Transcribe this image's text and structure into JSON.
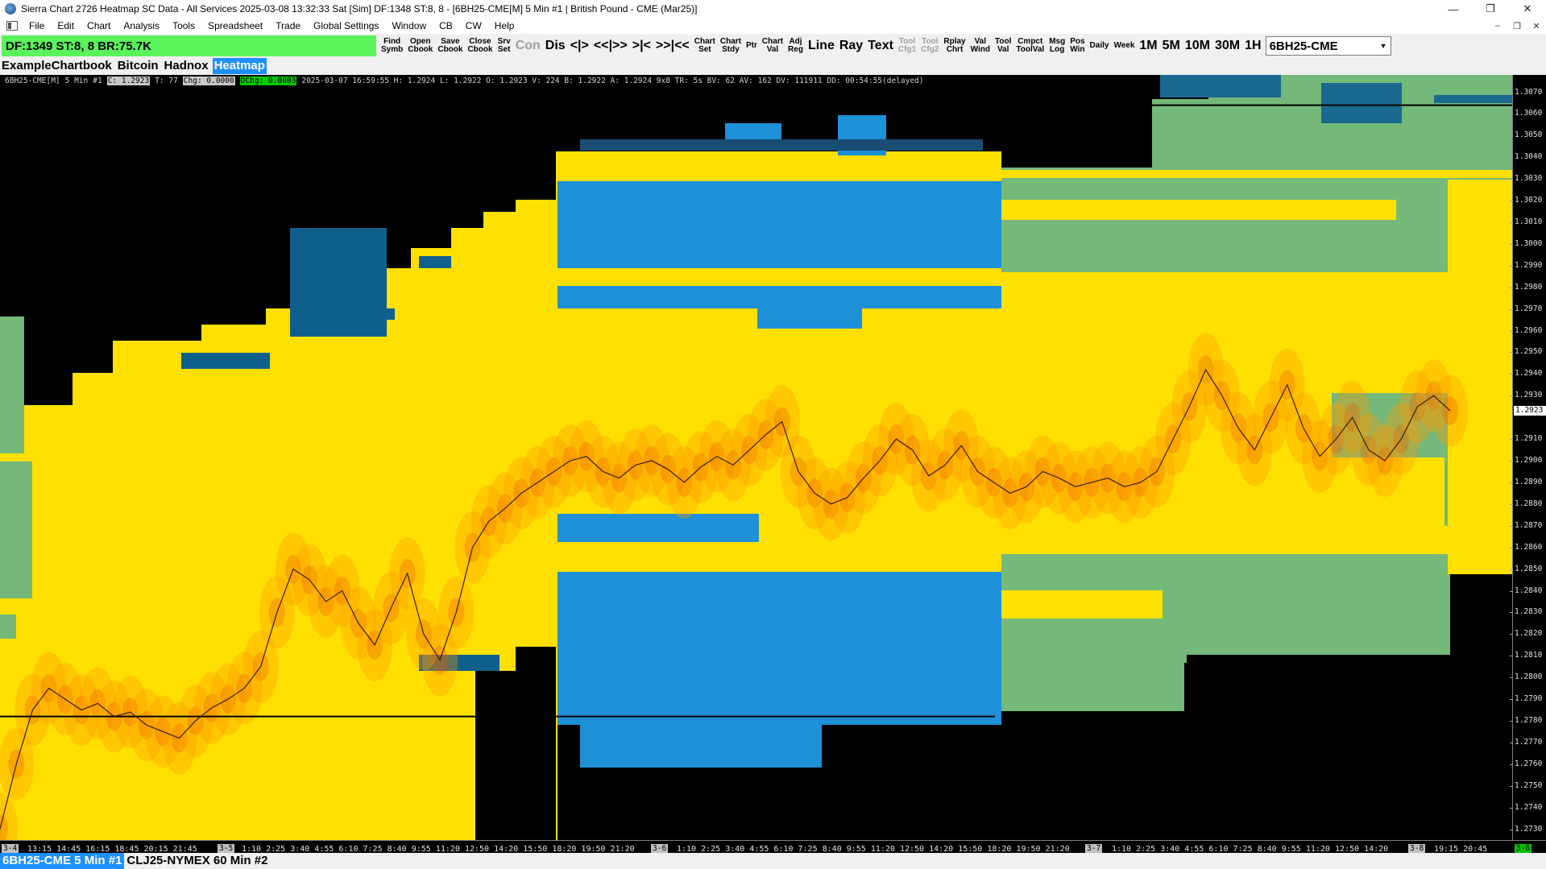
{
  "window": {
    "title": "Sierra Chart 2726 Heatmap SC Data - All Services 2025-03-08  13:32:33 Sat [Sim] DF:1348  ST:8, 8 - [6BH25-CME[M]  5 Min  #1 | British Pound - CME (Mar25)]",
    "minimize": "—",
    "maximize": "❐",
    "close": "✕"
  },
  "menu": {
    "items": [
      "File",
      "Edit",
      "Chart",
      "Analysis",
      "Tools",
      "Spreadsheet",
      "Trade",
      "Global Settings",
      "Window",
      "CB",
      "CW",
      "Help"
    ],
    "mdi": [
      "–",
      "❐",
      "✕"
    ]
  },
  "toolbar": {
    "status": "DF:1349  ST:8, 8  BR:75.7K",
    "buttons": [
      {
        "l1": "Find",
        "l2": "Symb",
        "disabled": false
      },
      {
        "l1": "Open",
        "l2": "Cbook",
        "disabled": false
      },
      {
        "l1": "Save",
        "l2": "Cbook",
        "disabled": false
      },
      {
        "l1": "Close",
        "l2": "Cbook",
        "disabled": false
      },
      {
        "l1": "Srv",
        "l2": "Set",
        "disabled": false
      }
    ],
    "big_buttons_1": [
      {
        "label": "Con",
        "disabled": true
      },
      {
        "label": "Dis",
        "disabled": false
      },
      {
        "label": "<|>",
        "disabled": false
      },
      {
        "label": "<<|>>",
        "disabled": false
      },
      {
        "label": ">|<",
        "disabled": false
      },
      {
        "label": ">>|<<",
        "disabled": false
      }
    ],
    "buttons_2": [
      {
        "l1": "Chart",
        "l2": "Set",
        "disabled": false
      },
      {
        "l1": "Chart",
        "l2": "Stdy",
        "disabled": false
      },
      {
        "l1": "Ptr",
        "l2": "",
        "disabled": false
      },
      {
        "l1": "Chart",
        "l2": "Val",
        "disabled": false
      },
      {
        "l1": "Adj",
        "l2": "Reg",
        "disabled": false
      }
    ],
    "big_buttons_2": [
      {
        "label": "Line",
        "disabled": false
      },
      {
        "label": "Ray",
        "disabled": false
      },
      {
        "label": "Text",
        "disabled": false
      }
    ],
    "buttons_3": [
      {
        "l1": "Tool",
        "l2": "Cfg1",
        "disabled": true
      },
      {
        "l1": "Tool",
        "l2": "Cfg2",
        "disabled": true
      },
      {
        "l1": "Rplay",
        "l2": "Chrt",
        "disabled": false
      },
      {
        "l1": "Val",
        "l2": "Wind",
        "disabled": false
      },
      {
        "l1": "Tool",
        "l2": "Val",
        "disabled": false
      },
      {
        "l1": "Cmpct",
        "l2": "ToolVal",
        "disabled": false
      },
      {
        "l1": "Msg",
        "l2": "Log",
        "disabled": false
      },
      {
        "l1": "Pos",
        "l2": "Win",
        "disabled": false
      },
      {
        "l1": "Daily",
        "l2": "",
        "disabled": false
      },
      {
        "l1": "Week",
        "l2": "",
        "disabled": false
      }
    ],
    "big_buttons_3": [
      {
        "label": "1M"
      },
      {
        "label": "5M"
      },
      {
        "label": "10M"
      },
      {
        "label": "30M"
      },
      {
        "label": "1H"
      }
    ],
    "symbol": "6BH25-CME"
  },
  "chartbook_tabs": [
    {
      "label": "ExampleChartbook",
      "active": false
    },
    {
      "label": "Bitcoin",
      "active": false
    },
    {
      "label": "Hadnox",
      "active": false
    },
    {
      "label": "Heatmap",
      "active": true
    }
  ],
  "chart_header": {
    "symbol": "6BH25-CME[M]",
    "interval": "5 Min",
    "num": "#1",
    "close": "C: 1.2923",
    "ticks": "T: 77",
    "chg": "Chg: 0.0000",
    "dchg": "DChg: 0.0003",
    "rest": "2025-03-07 16:59:55 H: 1.2924 L: 1.2922 O: 1.2923 V: 224 B: 1.2922 A: 1.2924 9x8 TR: 5s BV: 62 AV: 162 DV: 111911 DD: 00:54:55(delayed)"
  },
  "price_axis": {
    "labels": [
      "1.3070",
      "1.3060",
      "1.3050",
      "1.3040",
      "1.3030",
      "1.3020",
      "1.3010",
      "1.3000",
      "1.2990",
      "1.2980",
      "1.2970",
      "1.2960",
      "1.2950",
      "1.2940",
      "1.2930",
      "1.2910",
      "1.2900",
      "1.2890",
      "1.2880",
      "1.2870",
      "1.2860",
      "1.2850",
      "1.2840",
      "1.2830",
      "1.2820",
      "1.2810",
      "1.2800",
      "1.2790",
      "1.2780",
      "1.2770",
      "1.2760",
      "1.2750",
      "1.2740",
      "1.2730"
    ],
    "current": "1.2923"
  },
  "time_axis": {
    "dates": [
      {
        "label": "3-4",
        "green": false
      },
      {
        "label": "3-5",
        "green": false
      },
      {
        "label": "3-6",
        "green": false
      },
      {
        "label": "3-7",
        "green": false
      },
      {
        "label": "3-8",
        "green": false
      },
      {
        "label": "3-8",
        "green": true
      }
    ],
    "times_1": "13:15 14:45 16:15 18:45 20:15 21:45",
    "times_2": "1:10 2:25 3:40 4:55 6:10 7:25 8:40 9:55 11:20 12:50 14:20 15:50 18:20 19:50 21:20",
    "times_3": "1:10 2:25 3:40 4:55 6:10 7:25 8:40 9:55 11:20 12:50 14:20 15:50 18:20 19:50 21:20",
    "times_4": "1:10 2:25 3:40 4:55 6:10 7:25 8:40 9:55 11:20 12:50 14:20",
    "times_5": "19:15 20:45"
  },
  "chart_tabs": [
    {
      "label": "6BH25-CME  5 Min  #1",
      "active": true
    },
    {
      "label": "CLJ25-NYMEX  60 Min  #2",
      "active": false
    }
  ],
  "chart_data": {
    "type": "line",
    "title": "",
    "xlabel": "",
    "ylabel": "",
    "ylim": [
      1.2725,
      1.3078
    ],
    "series": [
      {
        "values": [
          1.273,
          1.276,
          1.2785,
          1.2795,
          1.279,
          1.2785,
          1.2788,
          1.2782,
          1.2784,
          1.2778,
          1.2775,
          1.2772,
          1.278,
          1.2786,
          1.279,
          1.2795,
          1.2805,
          1.283,
          1.285,
          1.2845,
          1.2835,
          1.284,
          1.2825,
          1.2815,
          1.2832,
          1.2848,
          1.282,
          1.2808,
          1.283,
          1.286,
          1.2872,
          1.2878,
          1.2885,
          1.289,
          1.2895,
          1.29,
          1.2902,
          1.2895,
          1.2892,
          1.2898,
          1.29,
          1.2896,
          1.289,
          1.2897,
          1.2902,
          1.2898,
          1.2905,
          1.2912,
          1.2918,
          1.2895,
          1.2885,
          1.288,
          1.2883,
          1.2892,
          1.29,
          1.291,
          1.2905,
          1.2893,
          1.2898,
          1.2907,
          1.2895,
          1.289,
          1.2885,
          1.2888,
          1.2895,
          1.2892,
          1.2888,
          1.289,
          1.2892,
          1.2888,
          1.289,
          1.2895,
          1.291,
          1.2925,
          1.2942,
          1.293,
          1.2915,
          1.2905,
          1.292,
          1.2935,
          1.2915,
          1.2902,
          1.291,
          1.292,
          1.2905,
          1.29,
          1.291,
          1.2925,
          1.293,
          1.2923
        ]
      }
    ]
  }
}
